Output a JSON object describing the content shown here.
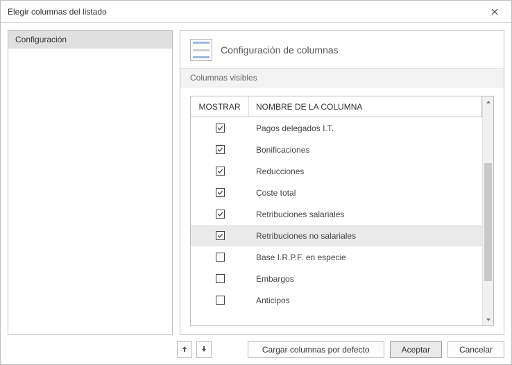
{
  "window": {
    "title": "Elegir columnas del listado"
  },
  "sidebar": {
    "items": [
      {
        "label": "Configuración",
        "selected": true
      }
    ]
  },
  "main": {
    "title": "Configuración de columnas",
    "section_label": "Columnas visibles",
    "headers": {
      "show": "MOSTRAR",
      "name": "NOMBRE DE LA COLUMNA"
    },
    "rows": [
      {
        "checked": true,
        "label": "Pagos delegados I.T.",
        "highlight": false
      },
      {
        "checked": true,
        "label": "Bonificaciones",
        "highlight": false
      },
      {
        "checked": true,
        "label": "Reducciones",
        "highlight": false
      },
      {
        "checked": true,
        "label": "Coste total",
        "highlight": false
      },
      {
        "checked": true,
        "label": "Retribuciones salariales",
        "highlight": false
      },
      {
        "checked": true,
        "label": "Retribuciones no salariales",
        "highlight": true
      },
      {
        "checked": false,
        "label": "Base I.R.P.F. en especie",
        "highlight": false
      },
      {
        "checked": false,
        "label": "Embargos",
        "highlight": false
      },
      {
        "checked": false,
        "label": "Anticipos",
        "highlight": false
      }
    ]
  },
  "footer": {
    "load_defaults": "Cargar columnas por defecto",
    "accept": "Aceptar",
    "cancel": "Cancelar"
  }
}
